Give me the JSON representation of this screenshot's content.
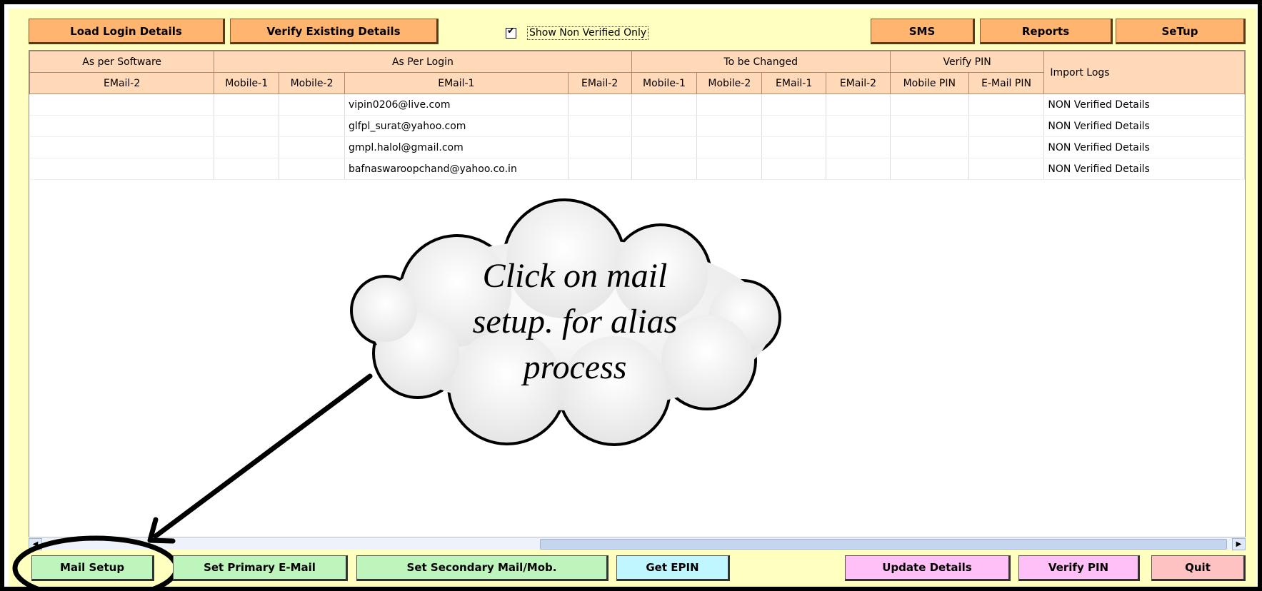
{
  "toolbar": {
    "load_login": "Load Login Details",
    "verify_existing": "Verify Existing Details",
    "show_non_verified_label": "Show Non Verified Only",
    "show_non_verified_checked": true,
    "sms": "SMS",
    "reports": "Reports",
    "setup": "SeTup"
  },
  "grid": {
    "groups": [
      "As per Software",
      "As Per Login",
      "To be Changed",
      "Verify PIN",
      "Import Logs"
    ],
    "columns": [
      "EMail-2",
      "Mobile-1",
      "Mobile-2",
      "EMail-1",
      "EMail-2",
      "Mobile-1",
      "Mobile-2",
      "EMail-1",
      "EMail-2",
      "Mobile PIN",
      "E-Mail PIN"
    ],
    "rows": [
      {
        "email1": "vipin0206@live.com",
        "log": "NON Verified Details"
      },
      {
        "email1": "glfpl_surat@yahoo.com",
        "log": "NON Verified Details"
      },
      {
        "email1": "gmpl.halol@gmail.com",
        "log": "NON Verified Details"
      },
      {
        "email1": "bafnaswaroopchand@yahoo.co.in",
        "log": "NON Verified Details"
      }
    ]
  },
  "annotation": {
    "line1": "Click on mail",
    "line2": "setup. for alias",
    "line3": "process"
  },
  "bottom": {
    "mail_setup": "Mail Setup",
    "set_primary": "Set Primary E-Mail",
    "set_secondary": "Set Secondary Mail/Mob.",
    "get_epin": "Get EPIN",
    "update_details": "Update Details",
    "verify_pin": "Verify PIN",
    "quit": "Quit"
  },
  "colors": {
    "panel": "#ffffc0",
    "top_button": "#ffb470",
    "header": "#ffd9b8",
    "green_button": "#bdf5bd",
    "cyan_button": "#bff6ff",
    "pink_button": "#ffbff7",
    "red_button": "#ffc2c2"
  }
}
